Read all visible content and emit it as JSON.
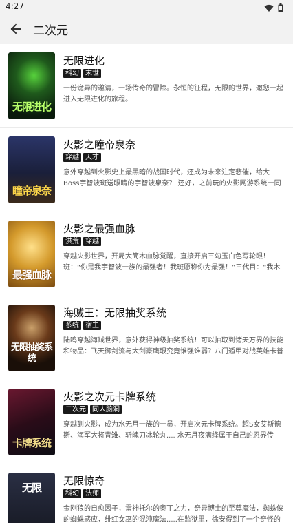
{
  "status": {
    "time": "4:27",
    "wifi_icon": "wifi-icon",
    "battery_icon": "battery-icon"
  },
  "header": {
    "title": "二次元",
    "back_icon": "back-arrow-icon"
  },
  "books": [
    {
      "title": "无限进化",
      "tags": [
        "科幻",
        "末世"
      ],
      "desc": "一份诡异的邀请，一场传奇的冒险。永恒的征程，无限的世界，邀您一起进入无限进化的旅程。",
      "cover_text": "无限进化",
      "cover_bg": "#0f2a14",
      "cover_accent": "#6be04a"
    },
    {
      "title": "火影之瞳帝泉奈",
      "tags": [
        "穿越",
        "天才"
      ],
      "desc": "意外穿越到火影史上最黑暗的战国时代，还成为未来注定悲催，给大Boss宇智波斑送眼睛的宇智波泉奈？ 还好，之前玩的火影网游系统一同跟随过来。。。",
      "cover_text": "瞳帝泉奈",
      "cover_bg": "#1b2240",
      "cover_accent": "#f2c94c"
    },
    {
      "title": "火影之最强血脉",
      "tags": [
        "洪荒",
        "穿越"
      ],
      "desc": "穿越火影世界，开局大筒木血脉觉醒，直接开启三勾玉白色写轮眼！斑：“你是我宇智波一族的最强者！我斑愿称你为最强！”三代目：“我木叶竟然有这...",
      "cover_text": "最强血脉",
      "cover_bg": "#c79a2e",
      "cover_accent": "#ffffff"
    },
    {
      "title": "海贼王：无限抽奖系统",
      "tags": [
        "系统",
        "宿主"
      ],
      "desc": "陆鸣穿越海贼世界，意外获得神级抽奖系统！可以抽取到诸天万界的技能和物品：飞天御剑流与大剑豪鹰眼究竟谁强谁弱？八门遁甲对战英雄卡普谁才...",
      "cover_text": "无限抽奖系统",
      "cover_bg": "#2a1a10",
      "cover_accent": "#ffffff"
    },
    {
      "title": "火影之次元卡牌系统",
      "tags": [
        "二次元",
        "同人脑洞"
      ],
      "desc": "穿越到火影，成为水无月一族的一员，开启次元卡牌系统。超S女艾斯德斯、海军大将青雉、斩魄刀冰轮丸.... 水无月夜满绛属于自己的忍界传说！",
      "cover_text": "卡牌系统",
      "cover_bg": "#3a1020",
      "cover_accent": "#e9d27a"
    },
    {
      "title": "无限惊奇",
      "tags": [
        "科幻",
        "法师"
      ],
      "desc": "金刚狼的自愈因子，雷神托尔的奥丁之力，奇异博士的至尊魔法，蜘蛛侠的蜘蛛感应，绯红女巫的混沌魔法.....在监狱里，徐安得到了一个奇怪的手机.....",
      "cover_text": "无限",
      "cover_bg": "#1c1f2a",
      "cover_accent": "#ffffff"
    }
  ]
}
